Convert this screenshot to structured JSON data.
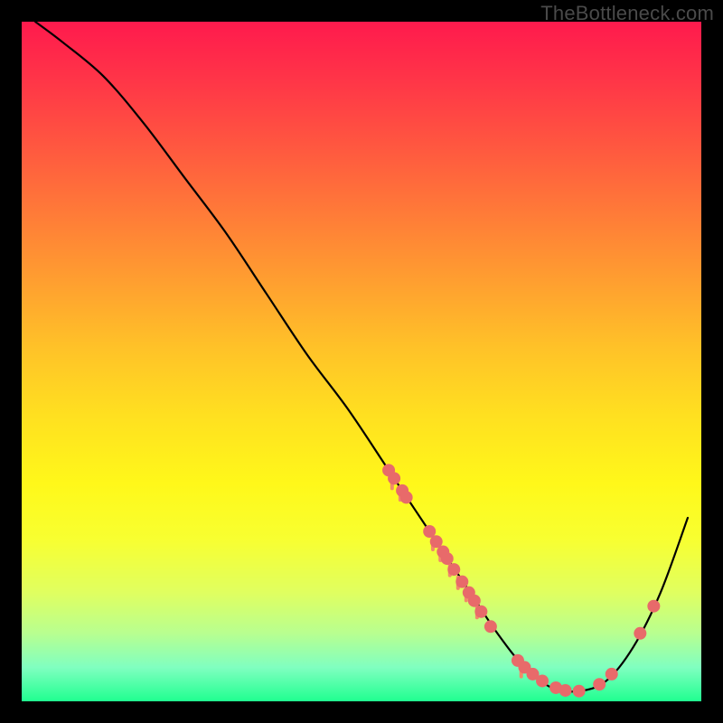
{
  "watermark": "TheBottleneck.com",
  "colors": {
    "curve": "#000000",
    "dot_fill": "#e86a6a",
    "tick_fill": "#f28a6a",
    "gradient_top": "#ff1a4d",
    "gradient_bottom": "#20ff90",
    "page_bg": "#000000"
  },
  "chart_data": {
    "type": "line",
    "title": "",
    "xlabel": "",
    "ylabel": "",
    "xlim": [
      0,
      1
    ],
    "ylim": [
      0,
      1
    ],
    "series": [
      {
        "name": "curve",
        "x": [
          0.02,
          0.06,
          0.12,
          0.18,
          0.24,
          0.3,
          0.36,
          0.42,
          0.48,
          0.54,
          0.58,
          0.62,
          0.66,
          0.7,
          0.74,
          0.78,
          0.82,
          0.86,
          0.9,
          0.94,
          0.98
        ],
        "y": [
          1.0,
          0.97,
          0.92,
          0.85,
          0.77,
          0.69,
          0.6,
          0.51,
          0.43,
          0.34,
          0.28,
          0.22,
          0.16,
          0.1,
          0.05,
          0.02,
          0.015,
          0.03,
          0.08,
          0.16,
          0.27
        ]
      }
    ],
    "points": [
      {
        "x": 0.54,
        "y": 0.34
      },
      {
        "x": 0.548,
        "y": 0.328
      },
      {
        "x": 0.56,
        "y": 0.31
      },
      {
        "x": 0.566,
        "y": 0.3
      },
      {
        "x": 0.6,
        "y": 0.25
      },
      {
        "x": 0.61,
        "y": 0.235
      },
      {
        "x": 0.62,
        "y": 0.22
      },
      {
        "x": 0.626,
        "y": 0.21
      },
      {
        "x": 0.636,
        "y": 0.194
      },
      {
        "x": 0.648,
        "y": 0.176
      },
      {
        "x": 0.658,
        "y": 0.16
      },
      {
        "x": 0.666,
        "y": 0.148
      },
      {
        "x": 0.676,
        "y": 0.132
      },
      {
        "x": 0.69,
        "y": 0.11
      },
      {
        "x": 0.73,
        "y": 0.06
      },
      {
        "x": 0.74,
        "y": 0.05
      },
      {
        "x": 0.752,
        "y": 0.04
      },
      {
        "x": 0.766,
        "y": 0.03
      },
      {
        "x": 0.786,
        "y": 0.02
      },
      {
        "x": 0.8,
        "y": 0.016
      },
      {
        "x": 0.82,
        "y": 0.015
      },
      {
        "x": 0.85,
        "y": 0.025
      },
      {
        "x": 0.868,
        "y": 0.04
      },
      {
        "x": 0.91,
        "y": 0.1
      },
      {
        "x": 0.93,
        "y": 0.14
      }
    ],
    "ticks": [
      {
        "x": 0.545,
        "y": 0.332
      },
      {
        "x": 0.557,
        "y": 0.315
      },
      {
        "x": 0.605,
        "y": 0.242
      },
      {
        "x": 0.616,
        "y": 0.226
      },
      {
        "x": 0.63,
        "y": 0.204
      },
      {
        "x": 0.642,
        "y": 0.185
      },
      {
        "x": 0.654,
        "y": 0.167
      },
      {
        "x": 0.67,
        "y": 0.142
      },
      {
        "x": 0.735,
        "y": 0.055
      }
    ]
  }
}
